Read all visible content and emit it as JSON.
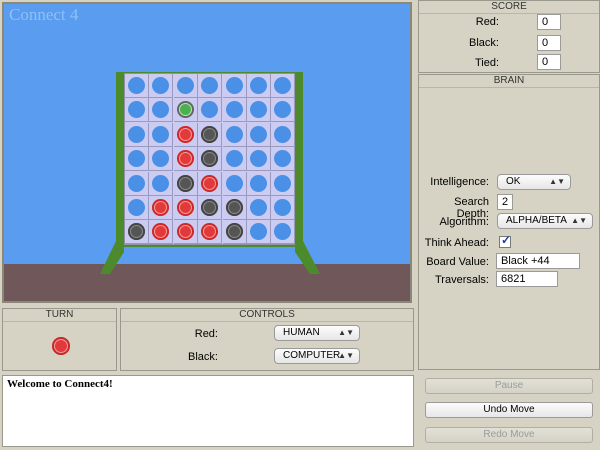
{
  "game": {
    "title": "Connect 4",
    "board": [
      [
        "empty",
        "empty",
        "empty",
        "empty",
        "empty",
        "empty",
        "empty"
      ],
      [
        "empty",
        "empty",
        "green",
        "empty",
        "empty",
        "empty",
        "empty"
      ],
      [
        "empty",
        "empty",
        "red",
        "black",
        "empty",
        "empty",
        "empty"
      ],
      [
        "empty",
        "empty",
        "red",
        "black",
        "empty",
        "empty",
        "empty"
      ],
      [
        "empty",
        "empty",
        "black",
        "red",
        "empty",
        "empty",
        "empty"
      ],
      [
        "empty",
        "red",
        "red",
        "black",
        "black",
        "empty",
        "empty"
      ],
      [
        "black",
        "red",
        "red",
        "red",
        "black",
        "empty",
        "empty"
      ]
    ],
    "colors": {
      "sky": "#5a9cf0",
      "ground": "#70585a",
      "frame": "#4d8a2c",
      "grid": "#ccccf2"
    }
  },
  "score": {
    "title": "SCORE",
    "red_label": "Red:",
    "red_value": "0",
    "black_label": "Black:",
    "black_value": "0",
    "tied_label": "Tied:",
    "tied_value": "0"
  },
  "brain": {
    "title": "BRAIN",
    "intelligence_label": "Intelligence:",
    "intelligence_value": "OK",
    "depth_label": "Search Depth:",
    "depth_value": "2",
    "algorithm_label": "Algorithm:",
    "algorithm_value": "ALPHA/BETA",
    "think_label": "Think Ahead:",
    "think_checked": true,
    "board_value_label": "Board Value:",
    "board_value": "Black +44",
    "traversals_label": "Traversals:",
    "traversals_value": "6821"
  },
  "turn": {
    "title": "TURN",
    "current": "red"
  },
  "controls": {
    "title": "CONTROLS",
    "red_label": "Red:",
    "red_value": "HUMAN",
    "black_label": "Black:",
    "black_value": "COMPUTER"
  },
  "log": {
    "text": "Welcome to Connect4!"
  },
  "buttons": {
    "pause": "Pause",
    "undo": "Undo Move",
    "redo": "Redo Move"
  },
  "icons": {
    "check": "checkmark-icon",
    "chevron": "chevron-updown-icon"
  }
}
